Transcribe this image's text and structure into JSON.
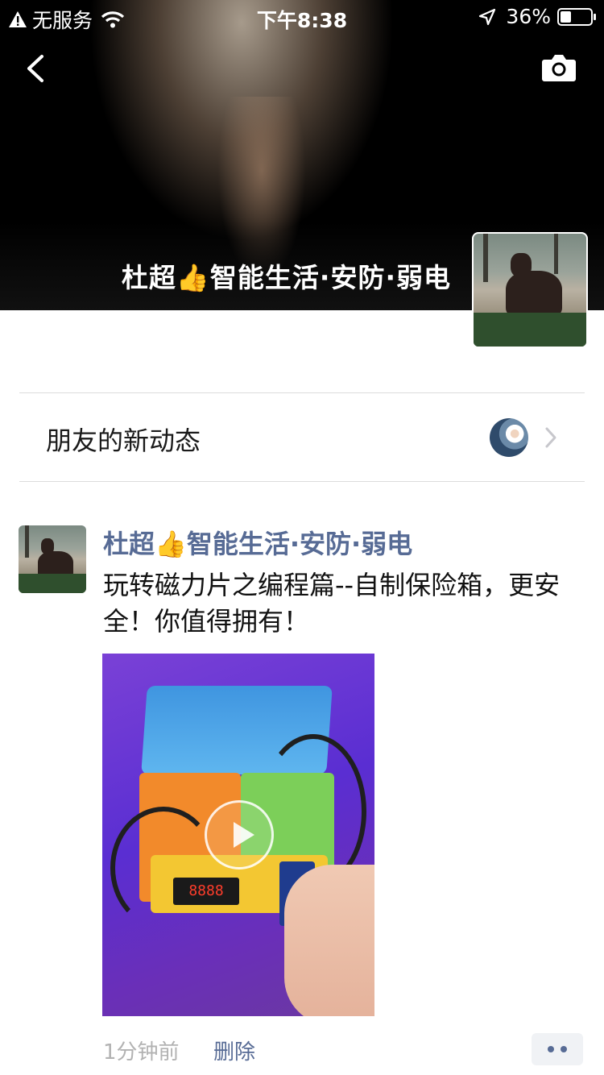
{
  "status_bar": {
    "carrier": "无服务",
    "time": "下午8:38",
    "battery": "36%",
    "battery_level": 0.36
  },
  "cover": {
    "name": "杜超👍智能生活·安防·弱电"
  },
  "friends_updates": {
    "label": "朋友的新动态"
  },
  "post": {
    "author": "杜超👍智能生活·安防·弱电",
    "text": "玩转磁力片之编程篇--自制保险箱，更安全！你值得拥有！",
    "video_display": "8888",
    "time": "1分钟前",
    "delete_label": "删除"
  },
  "colors": {
    "link": "#576b95",
    "muted": "#b2b2b2",
    "cover_bg": "#000000"
  },
  "icons": [
    "warning-icon",
    "wifi-icon",
    "location-icon",
    "battery-icon",
    "back-icon",
    "camera-icon",
    "chevron-right-icon",
    "play-icon",
    "more-icon"
  ]
}
